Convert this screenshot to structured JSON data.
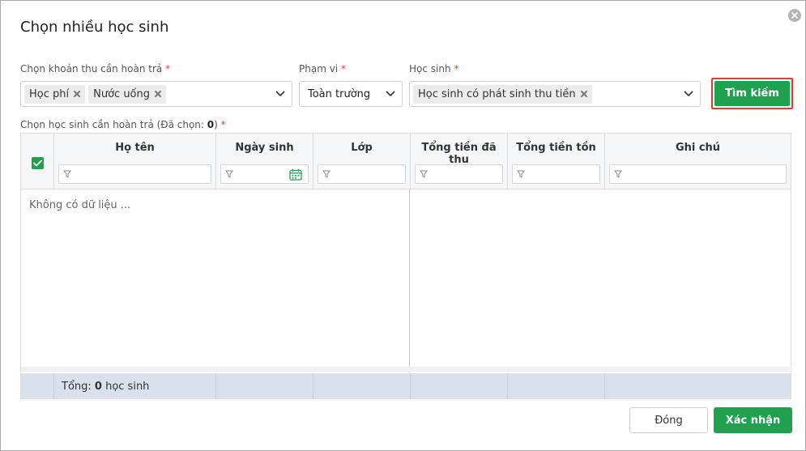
{
  "dialog": {
    "title": "Chọn nhiều học sinh",
    "close_icon": "close-circle-icon"
  },
  "filters": {
    "fee": {
      "label": "Chọn khoản thu cần hoàn trả",
      "required_mark": "*",
      "tags": [
        "Học phí",
        "Nước uống"
      ]
    },
    "scope": {
      "label": "Phạm vi",
      "required_mark": "*",
      "value": "Toàn trường"
    },
    "student": {
      "label": "Học sinh",
      "required_mark": "*",
      "tags": [
        "Học sinh có phát sinh thu tiền"
      ]
    },
    "search_label": "Tìm kiếm"
  },
  "grid": {
    "label_prefix": "Chọn học sinh cần hoàn trả (Đã chọn: ",
    "selected_count": "0",
    "label_suffix": ")",
    "required_mark": "*",
    "columns": [
      "Họ tên",
      "Ngày sinh",
      "Lớp",
      "Tổng tiền đã thu",
      "Tổng tiền tồn",
      "Ghi chú"
    ],
    "empty_text": "Không có dữ liệu ...",
    "footer": {
      "total_prefix": "Tổng: ",
      "total_count": "0",
      "total_suffix": " học sinh"
    }
  },
  "actions": {
    "close_label": "Đóng",
    "confirm_label": "Xác nhận"
  },
  "colors": {
    "primary": "#1fa150",
    "required": "#e53935",
    "highlight_border": "#e53935",
    "footer_bg": "#d9e0ee"
  }
}
